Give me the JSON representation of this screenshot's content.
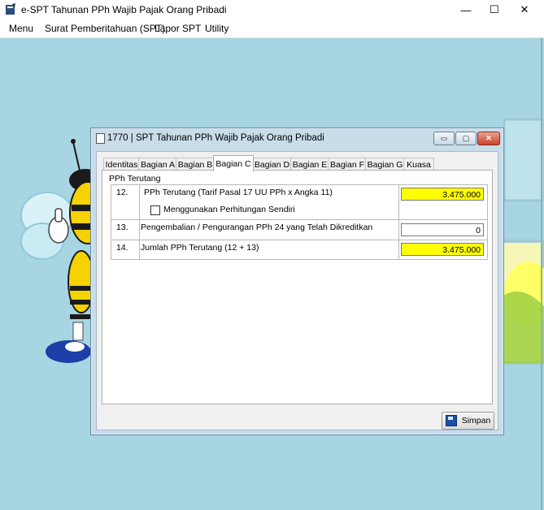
{
  "window": {
    "title": "e-SPT Tahunan PPh Wajib Pajak Orang Pribadi",
    "minimize": "—",
    "maximize": "☐",
    "close": "✕"
  },
  "menu": {
    "items": [
      "Menu",
      "Surat Pemberitahuan (SPT)",
      "Lapor SPT",
      "Utility"
    ]
  },
  "dialog": {
    "title": "1770 | SPT Tahunan PPh Wajib Pajak Orang Pribadi",
    "controls": {
      "minimize": "▭",
      "maximize": "▢",
      "close": "✕"
    },
    "tabs": [
      "Identitas",
      "Bagian A",
      "Bagian B",
      "Bagian C",
      "Bagian D",
      "Bagian E",
      "Bagian F",
      "Bagian G",
      "Kuasa"
    ],
    "active_tab": "Bagian C",
    "section_label": "PPh Terutang",
    "rows": [
      {
        "no": "12.",
        "label": "PPh Terutang (Tarif Pasal 17 UU PPh x Angka 11)",
        "value": "3.475.000",
        "highlight": "#ffff00",
        "checkbox_label": "Menggunakan Perhitungan Sendiri",
        "checked": false
      },
      {
        "no": "13.",
        "label": "Pengembalian / Pengurangan PPh 24 yang Telah Dikreditkan",
        "value": "0",
        "highlight": "#ffffff"
      },
      {
        "no": "14.",
        "label": "Jumlah PPh Terutang (12 + 13)",
        "value": "3.475.000",
        "highlight": "#ffff00"
      }
    ],
    "save_label": "Simpan"
  },
  "colors": {
    "desktop_bg": "#a8d5e2",
    "input_highlight": "#ffff00"
  }
}
